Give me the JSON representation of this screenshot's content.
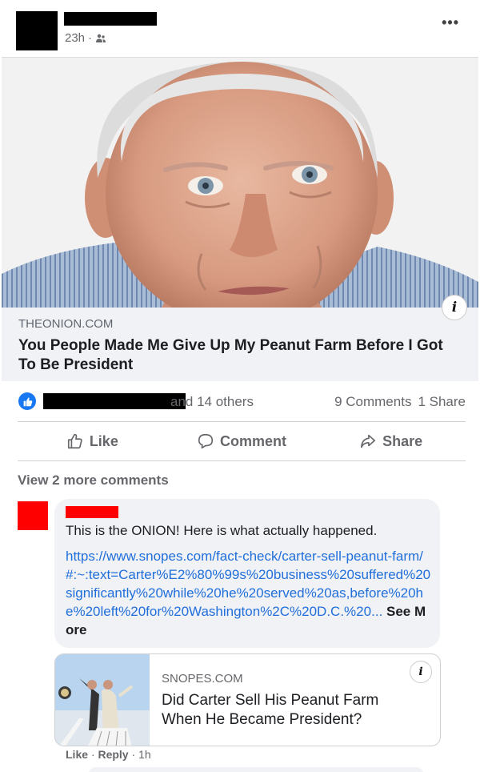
{
  "post": {
    "time": "23h",
    "privacy_icon": "friends-icon",
    "more_icon": "more-options-icon",
    "more_label": "•••"
  },
  "link": {
    "domain": "THEONION.COM",
    "title": "You People Made Me Give Up My Peanut Farm Before I Got To Be President",
    "info_label": "i"
  },
  "reactions": {
    "others_text": "and 14 others",
    "comments": "9 Comments",
    "shares": "1 Share"
  },
  "actions": {
    "like": "Like",
    "comment": "Comment",
    "share": "Share"
  },
  "comments": {
    "view_more": "View 2 more comments",
    "first": {
      "text": "This is the ONION! Here is what actually happened.",
      "link": "https://www.snopes.com/fact-check/carter-sell-peanut-farm/#:~:text=Carter%E2%80%99s%20business%20suffered%20significantly%20while%20he%20served%20as,before%20he%20left%20for%20Washington%2C%20D.C.%20",
      "ellipsis": "...",
      "see_more": "See More",
      "preview": {
        "domain": "SNOPES.COM",
        "title": "Did Carter Sell His Peanut Farm When He Became President?",
        "info_label": "i"
      },
      "actions": {
        "like": "Like",
        "reply": "Reply",
        "time": "1h",
        "sep": " · "
      }
    }
  },
  "colors": {
    "accent": "#1877f2",
    "link": "#216fdb",
    "muted": "#65676b",
    "redact": "#000000",
    "redact_red": "#ff0000"
  }
}
